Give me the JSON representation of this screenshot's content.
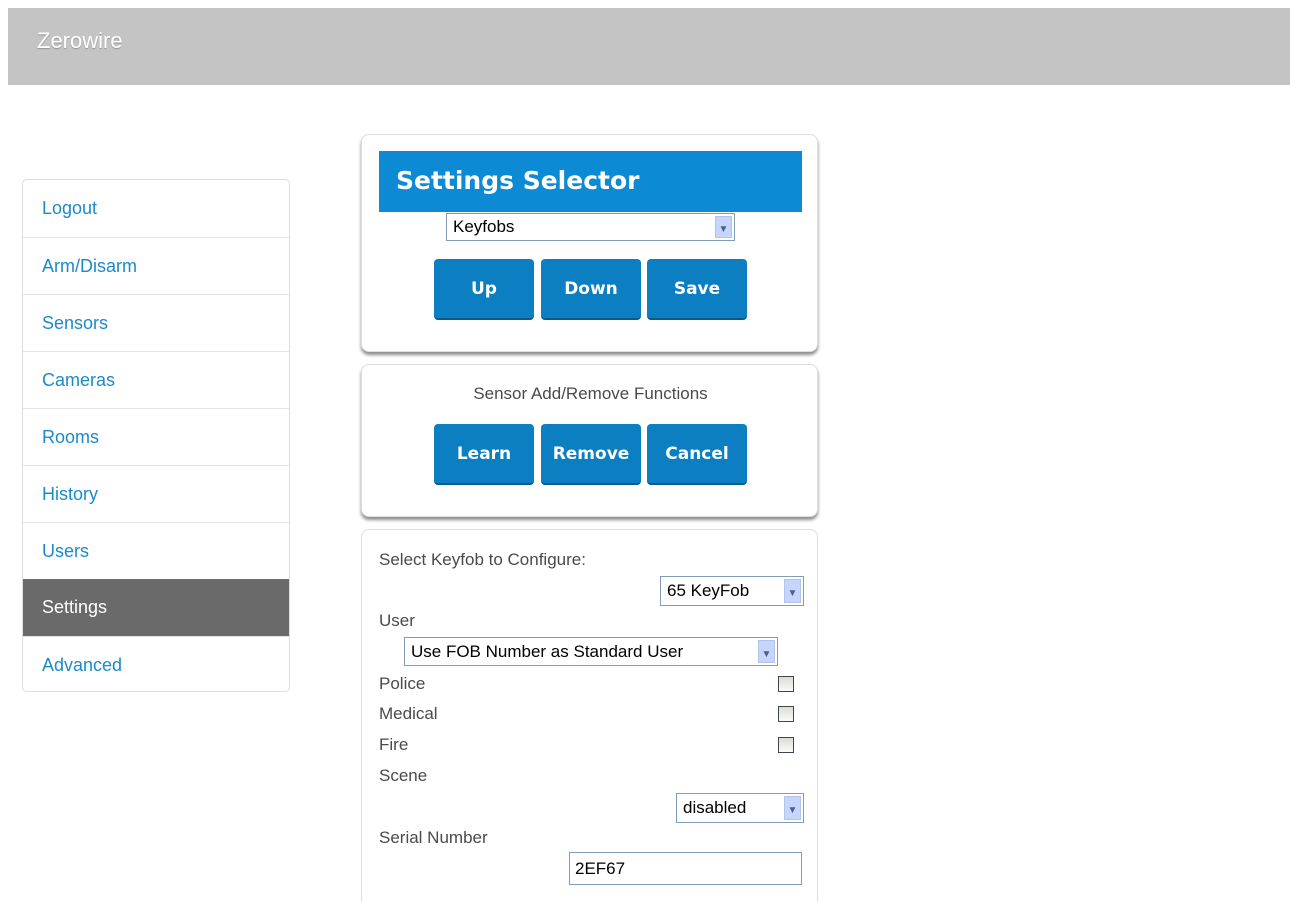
{
  "app": {
    "title": "Zerowire"
  },
  "sidebar": {
    "items": [
      {
        "label": "Logout"
      },
      {
        "label": "Arm/Disarm"
      },
      {
        "label": "Sensors"
      },
      {
        "label": "Cameras"
      },
      {
        "label": "Rooms"
      },
      {
        "label": "History"
      },
      {
        "label": "Users"
      },
      {
        "label": "Settings",
        "active": true
      },
      {
        "label": "Advanced"
      }
    ]
  },
  "settings_selector": {
    "title": "Settings Selector",
    "selected": "Keyfobs",
    "buttons": {
      "up": "Up",
      "down": "Down",
      "save": "Save"
    }
  },
  "sensor_functions": {
    "caption": "Sensor Add/Remove Functions",
    "buttons": {
      "learn": "Learn",
      "remove": "Remove",
      "cancel": "Cancel"
    }
  },
  "keyfob_config": {
    "select_label": "Select Keyfob to Configure:",
    "keyfob_selected": "65 KeyFob",
    "user_label": "User",
    "user_selected": "Use FOB Number as Standard User",
    "police_label": "Police",
    "medical_label": "Medical",
    "fire_label": "Fire",
    "police_checked": false,
    "medical_checked": false,
    "fire_checked": false,
    "scene_label": "Scene",
    "scene_selected": "disabled",
    "serial_label": "Serial Number",
    "serial_value": "2EF67"
  },
  "colors": {
    "topbar": "#c4c4c4",
    "header_blue": "#0c8ad4",
    "button_blue": "#0c7fc2",
    "link_blue": "#1b8ac8",
    "active_nav": "#6a6a6a"
  },
  "icons": {
    "dropdown": "chevron-down-icon"
  }
}
